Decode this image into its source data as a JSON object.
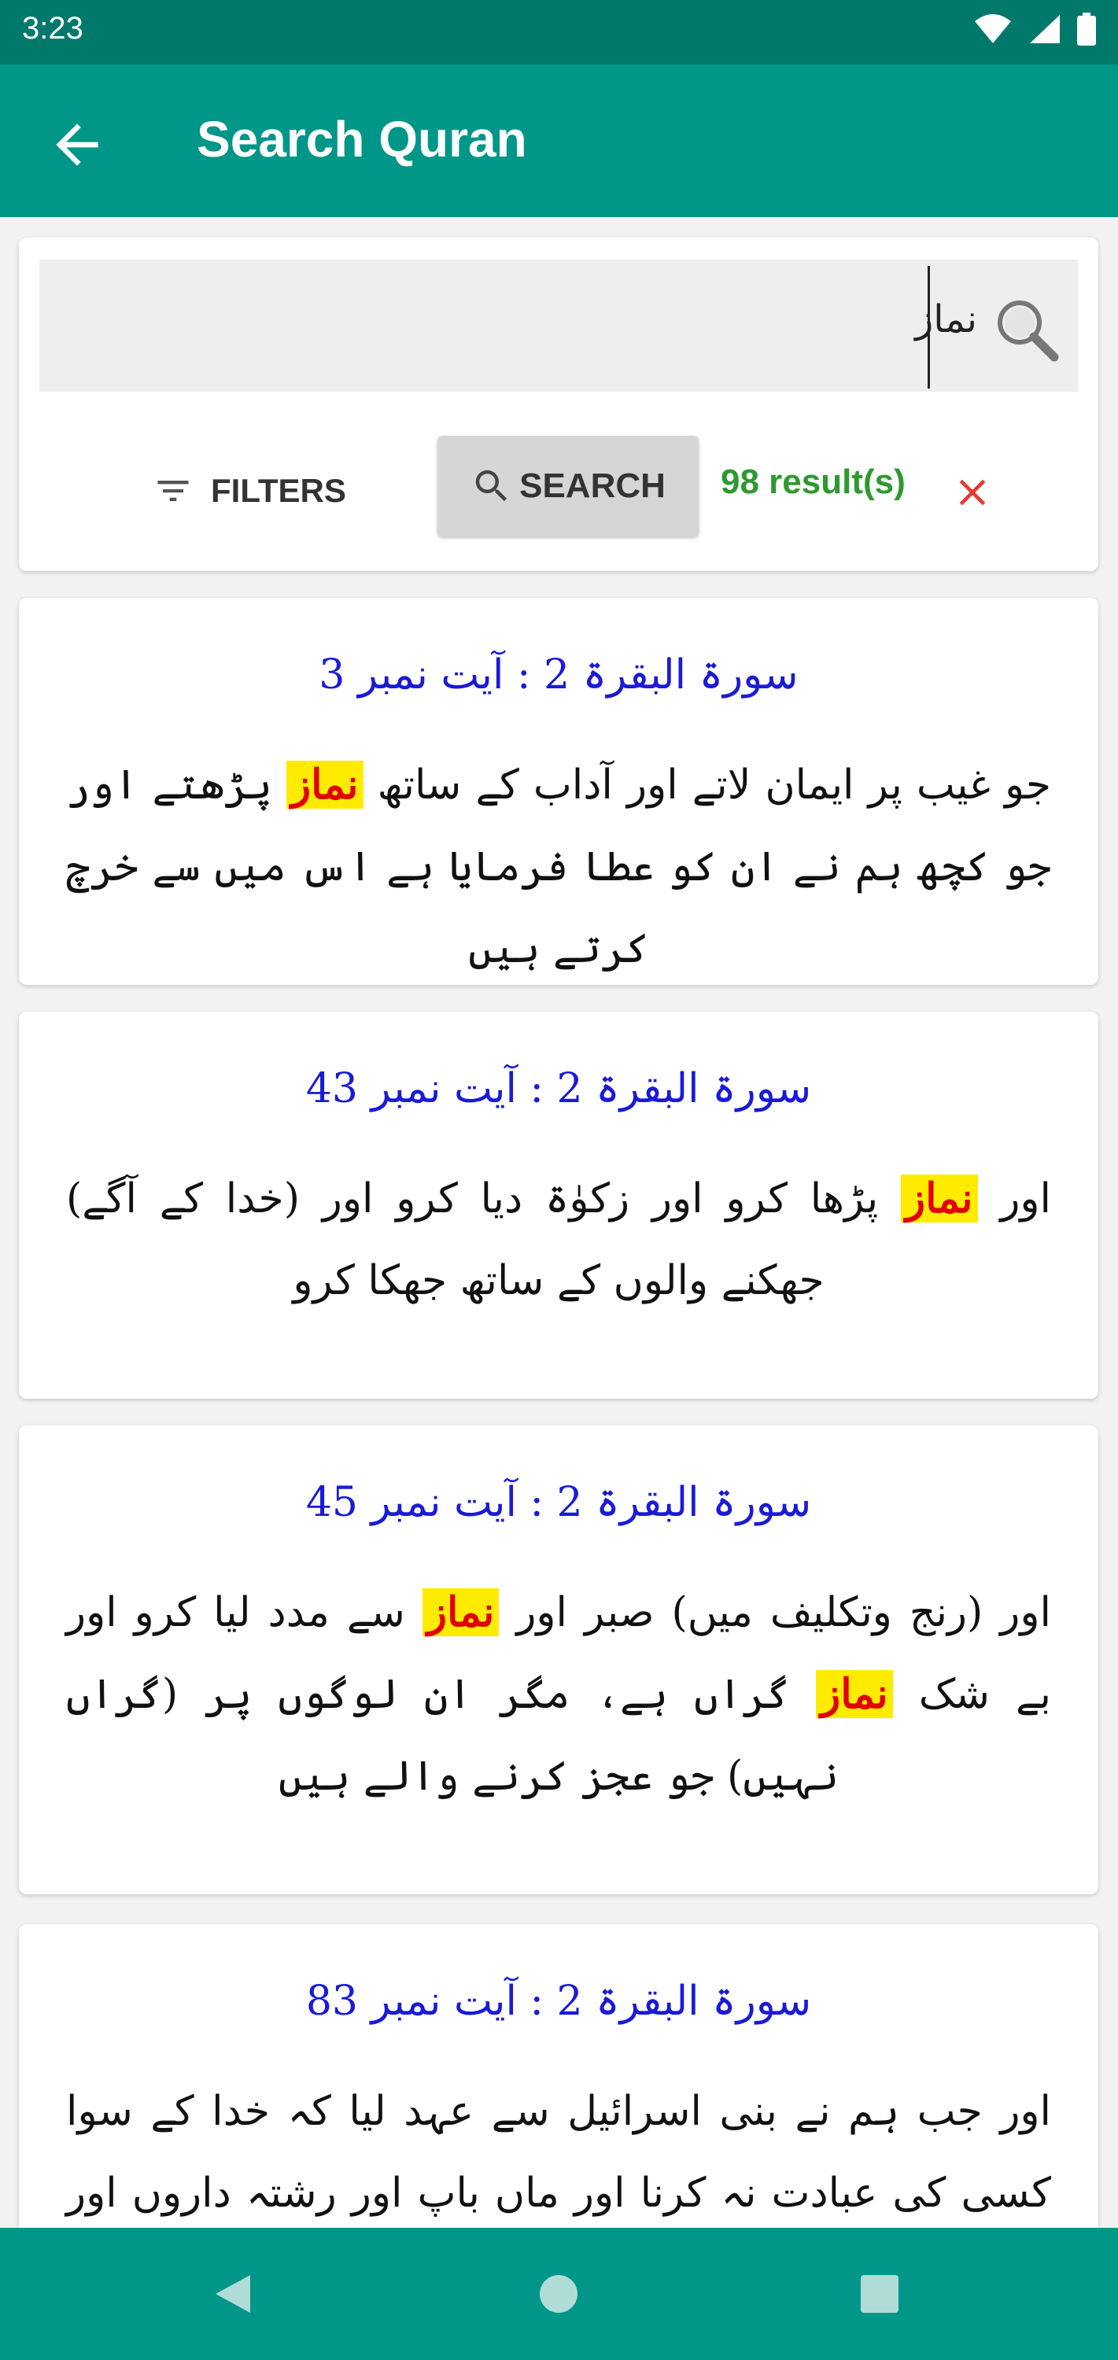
{
  "status_bar": {
    "time": "3:23"
  },
  "app_bar": {
    "title": "Search Quran"
  },
  "search": {
    "query": "نماز",
    "filters_label": "FILTERS",
    "search_label": "SEARCH",
    "results_count": "98 result(s)"
  },
  "results": [
    {
      "title": "سورۃ البقرۃ 2 : آیت نمبر 3",
      "before": "جو غیب پر ایمان لاتے اور آداب کے ساتھ ",
      "highlight": "نماز",
      "after": " پڑھتے اور جو کچھ ہم نے ان کو عطا فرمایا ہے اس میں سے خرچ کرتے ہیں"
    },
    {
      "title": "سورۃ البقرۃ 2 : آیت نمبر 43",
      "before": "اور ",
      "highlight": "نماز",
      "after": " پڑھا کرو اور زکوٰۃ دیا کرو اور (خدا کے آگے) جھکنے والوں کے ساتھ جھکا کرو"
    },
    {
      "title": "سورۃ البقرۃ 2 : آیت نمبر 45",
      "before": "اور (رنج وتکلیف میں) صبر اور ",
      "highlight": "نماز",
      "middle": " سے مدد لیا کرو اور بے شک ",
      "highlight2": "نماز",
      "after": " گراں ہے، مگر ان لوگوں پر (گراں نہیں) جو عجز کرنے والے ہیں"
    },
    {
      "title": "سورۃ البقرۃ 2 : آیت نمبر 83",
      "before": "اور جب ہم نے بنی اسرائیل سے عہد لیا کہ خدا کے سوا کسی کی عبادت نہ کرنا اور ماں باپ اور رشتہ داروں اور یتیموں اور"
    }
  ],
  "colors": {
    "primary": "#009688",
    "primary_dark": "#00796b",
    "result_title": "#1a1ad6",
    "highlight_bg": "#ffeb00",
    "highlight_text": "#e00000",
    "count_text": "#2e9a2e",
    "clear_icon": "#e53935"
  },
  "icons": [
    "wifi-icon",
    "signal-icon",
    "battery-icon",
    "back-arrow-icon",
    "search-icon",
    "filter-icon",
    "clear-icon",
    "nav-back-icon",
    "nav-home-icon",
    "nav-recents-icon"
  ]
}
